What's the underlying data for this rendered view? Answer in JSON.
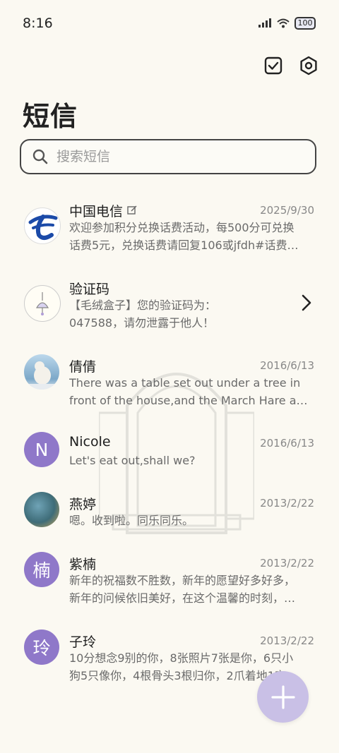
{
  "status_bar": {
    "time": "8:16",
    "battery": "100"
  },
  "header": {
    "title": "短信",
    "actions": [
      "checkbox-icon",
      "settings-icon"
    ]
  },
  "search": {
    "placeholder": "搜索短信",
    "value": ""
  },
  "conversations": [
    {
      "name": "中国电信",
      "date": "2025/9/30",
      "line1": "欢迎参加积分兑换话费活动，每500分可兑换",
      "line2": "话费5元，兑换话费请回复106或jfdh#话费…",
      "avatar": "china-telecom-logo"
    },
    {
      "name": "验证码",
      "date": "",
      "line1": "【毛绒盒子】您的验证码为：",
      "line2": "047588，请勿泄露于他人！",
      "avatar": "verification-avatar"
    },
    {
      "name": "倩倩",
      "date": "2016/6/13",
      "line1": "There was a table set out under a tree in",
      "line2": "front of the house,and the March Hare an…",
      "avatar": "polar-bear-photo"
    },
    {
      "name": "Nicole",
      "date": "2016/6/13",
      "line1": "Let's eat out,shall we?",
      "line2": "",
      "avatar_letter": "N"
    },
    {
      "name": "燕婷",
      "date": "2013/2/22",
      "line1": "嗯。收到啦。同乐同乐。",
      "line2": "",
      "avatar": "landscape-photo"
    },
    {
      "name": "紫楠",
      "date": "2013/2/22",
      "line1": "新年的祝福数不胜数，新年的愿望好多好多，",
      "line2": "新年的问候依旧美好，在这个温馨的时刻，…",
      "avatar_letter": "楠"
    },
    {
      "name": "子玲",
      "date": "2013/2/22",
      "line1": "10分想念9别的你，8张照片7张是你，6只小",
      "line2": "狗5只像你，4根骨头3根归你，2爪着地1定…",
      "avatar_letter": "玲"
    }
  ],
  "fab": {
    "icon": "plus-icon"
  },
  "colors": {
    "background": "#fbf9f2",
    "avatar_purple": "#8f78c9",
    "fab": "#c9c0e6"
  }
}
